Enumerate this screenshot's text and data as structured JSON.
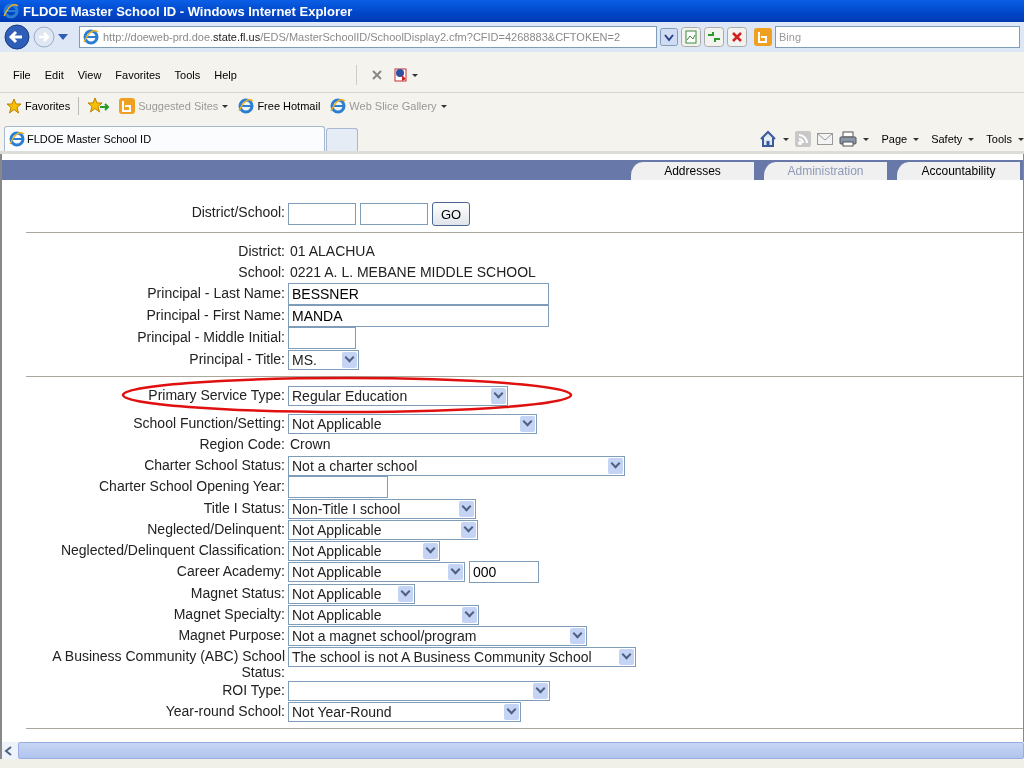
{
  "window": {
    "title": "FLDOE Master School ID - Windows Internet Explorer"
  },
  "address_bar": {
    "url": "http://doeweb-prd.doe.**state.fl.us**/EDS/MasterSchoolID/SchoolDisplay2.cfm?CFID=4268883&CFTOKEN=2",
    "search_placeholder": "Bing"
  },
  "menu": [
    "File",
    "Edit",
    "View",
    "Favorites",
    "Tools",
    "Help"
  ],
  "favorites_bar": {
    "label": "Favorites",
    "links": [
      {
        "label": "Suggested Sites",
        "disabled": true,
        "dropdown": true
      },
      {
        "label": "Free Hotmail",
        "disabled": false,
        "dropdown": false
      },
      {
        "label": "Web Slice Gallery",
        "disabled": true,
        "dropdown": true
      }
    ]
  },
  "browser_tab": {
    "title": "FLDOE Master School ID"
  },
  "command_bar": [
    "Page",
    "Safety",
    "Tools"
  ],
  "page_tabs": [
    {
      "label": "Addresses",
      "disabled": false
    },
    {
      "label": "Administration",
      "disabled": true
    },
    {
      "label": "Accountability",
      "disabled": false
    }
  ],
  "lookup": {
    "label": "District/School:",
    "button": "GO"
  },
  "school_info": [
    {
      "kind": "static",
      "label": "District:",
      "value": "01 ALACHUA"
    },
    {
      "kind": "static",
      "label": "School:",
      "value": "0221 A. L. MEBANE MIDDLE SCHOOL"
    },
    {
      "kind": "text",
      "label": "Principal - Last Name:",
      "value": "BESSNER"
    },
    {
      "kind": "text",
      "label": "Principal - First Name:",
      "value": "MANDA"
    },
    {
      "kind": "text",
      "label": "Principal - Middle Initial:"
    },
    {
      "kind": "select",
      "label": "Principal - Title:",
      "value": "MS."
    }
  ],
  "school_details": [
    {
      "kind": "select",
      "label": "Primary Service Type:",
      "value": "Regular Education",
      "highlighted": true
    },
    {
      "kind": "select",
      "label": "School Function/Setting:",
      "value": "Not Applicable"
    },
    {
      "kind": "static",
      "label": "Region Code:",
      "value": "Crown"
    },
    {
      "kind": "select",
      "label": "Charter School Status:",
      "value": "Not a charter school"
    },
    {
      "kind": "text",
      "label": "Charter School Opening Year:"
    },
    {
      "kind": "select",
      "label": "Title I Status:",
      "value": "Non-Title I school"
    },
    {
      "kind": "select",
      "label": "Neglected/Delinquent:",
      "value": "Not Applicable"
    },
    {
      "kind": "select",
      "label": "Neglected/Delinquent Classification:",
      "value": "Not Applicable"
    },
    {
      "kind": "select_code",
      "label": "Career Academy:",
      "value": "Not Applicable",
      "code": "000"
    },
    {
      "kind": "select",
      "label": "Magnet Status:",
      "value": "Not Applicable"
    },
    {
      "kind": "select",
      "label": "Magnet Specialty:",
      "value": "Not Applicable"
    },
    {
      "kind": "select",
      "label": "Magnet Purpose:",
      "value": "Not a magnet school/program"
    },
    {
      "kind": "select",
      "label": "A Business Community (ABC) School Status:",
      "value": "The school is not A Business Community School"
    },
    {
      "kind": "select",
      "label": "ROI Type:"
    },
    {
      "kind": "select",
      "label": "Year-round School:",
      "value": "Not Year-Round"
    }
  ]
}
